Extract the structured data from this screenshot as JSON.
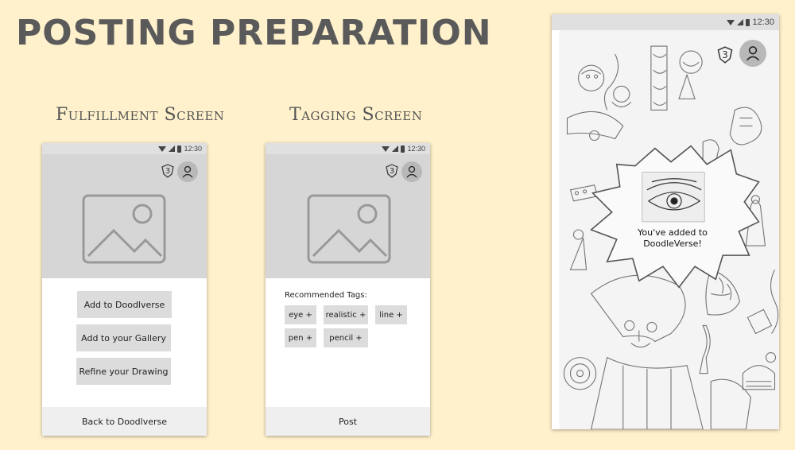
{
  "title": "POSTING PREPARATION",
  "fulfillment": {
    "label": "Fulfillment Screen",
    "time": "12:30",
    "badge": "3",
    "buttons": [
      "Add to Doodlverse",
      "Add to your Gallery",
      "Refine your Drawing"
    ],
    "footer": "Back to Doodlverse"
  },
  "tagging": {
    "label": "Tagging Screen",
    "time": "12:30",
    "badge": "3",
    "heading": "Recommended Tags:",
    "tags": [
      "eye +",
      "realistic +",
      "line +",
      "pen +",
      "pencil +"
    ],
    "footer": "Post"
  },
  "confirmation": {
    "time": "12:30",
    "badge": "3",
    "message_line1": "You've added to",
    "message_line2": "DoodleVerse!"
  }
}
